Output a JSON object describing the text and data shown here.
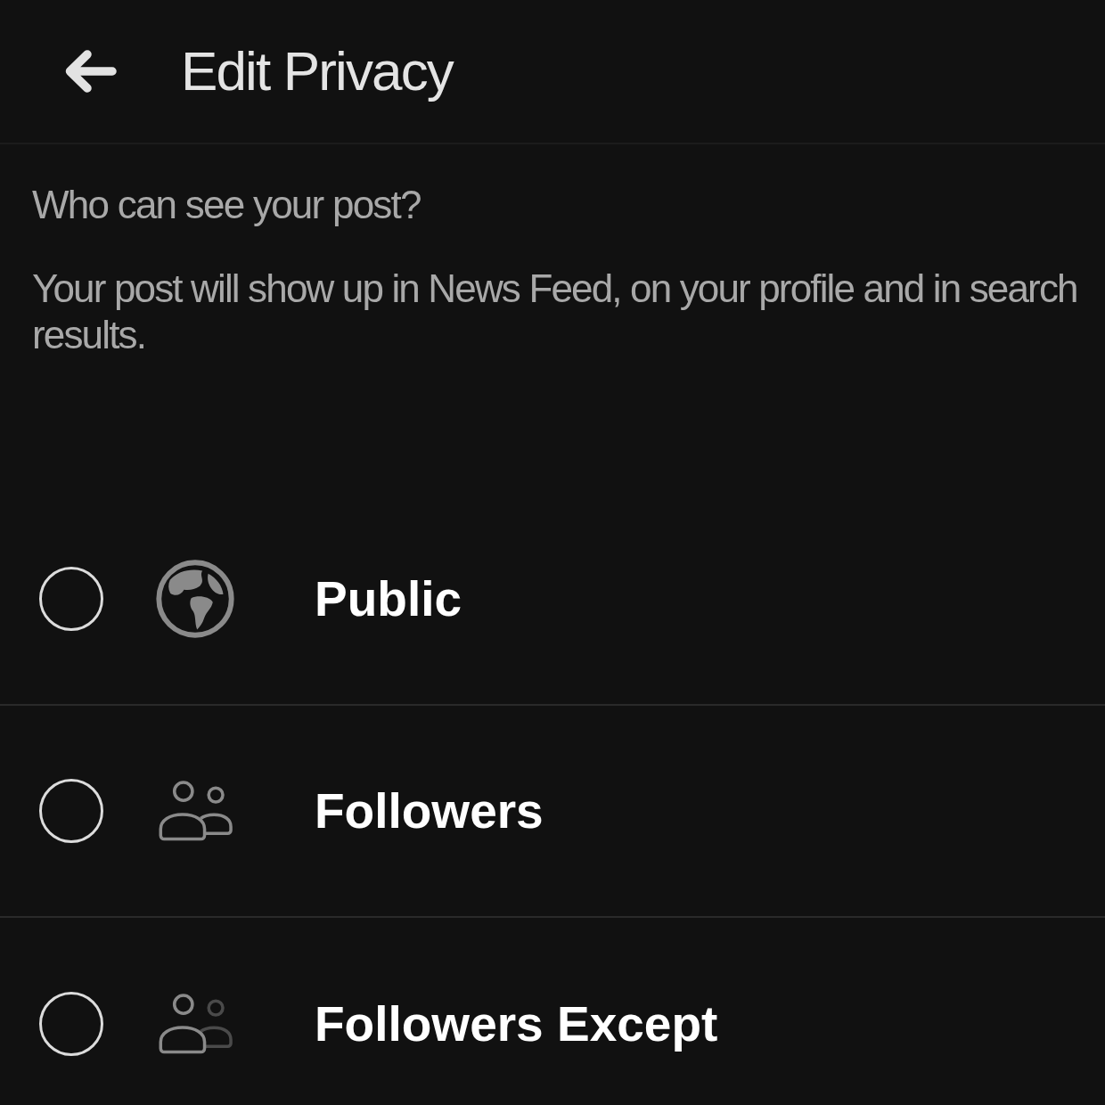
{
  "header": {
    "title": "Edit Privacy"
  },
  "intro": {
    "question": "Who can see your post?",
    "description": "Your post will show up in News Feed, on your profile and in search results."
  },
  "options": [
    {
      "kind": "globe",
      "label": "Public",
      "selected": false
    },
    {
      "kind": "group",
      "label": "Followers",
      "selected": false
    },
    {
      "kind": "partial",
      "label": "Followers Except",
      "selected": false
    }
  ]
}
